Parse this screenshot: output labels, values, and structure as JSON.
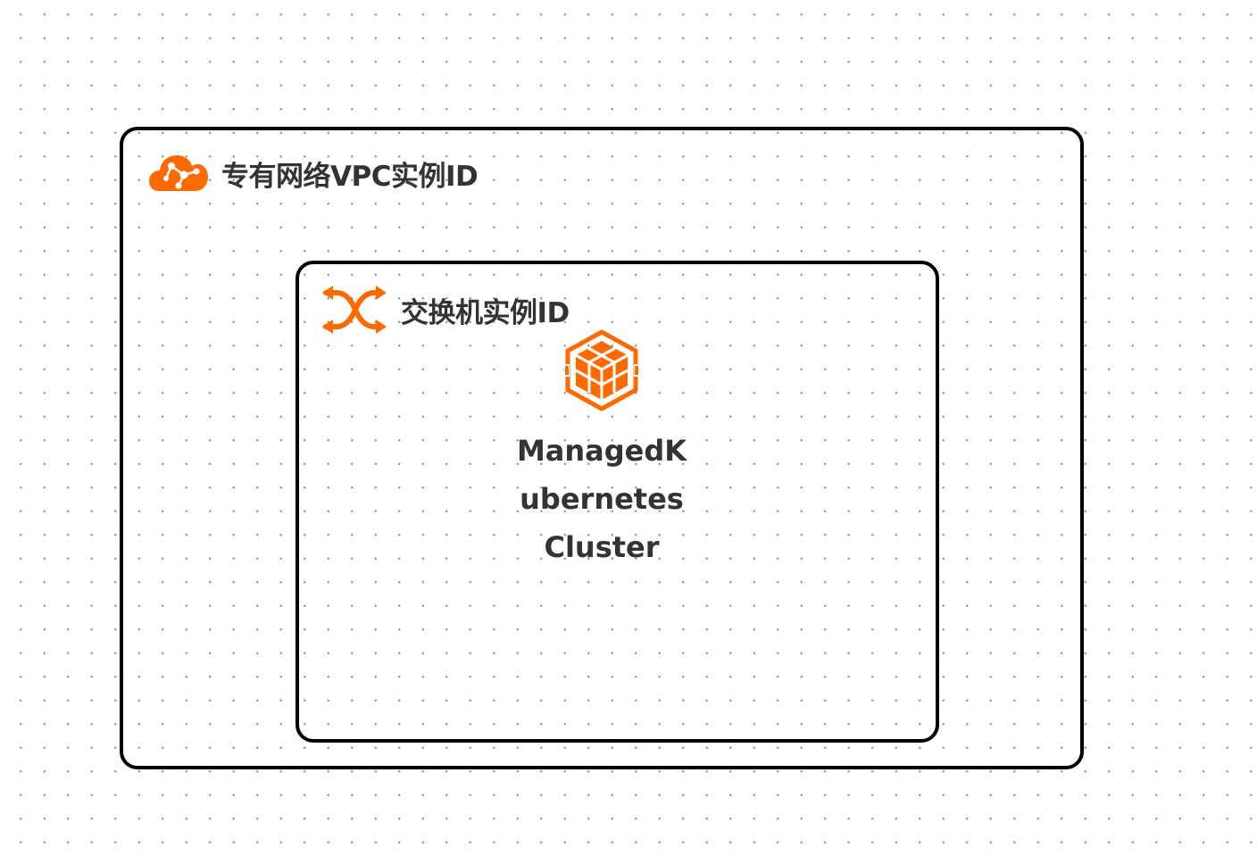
{
  "accent_color": "#FF6A00",
  "vpc": {
    "label": "专有网络VPC实例ID",
    "icon": "vpc-cloud-icon"
  },
  "vswitch": {
    "label": "交换机实例ID",
    "icon": "vswitch-shuffle-icon"
  },
  "node": {
    "icon": "kubernetes-cube-icon",
    "label_lines": [
      "ManagedK",
      "ubernetes",
      "Cluster"
    ]
  }
}
